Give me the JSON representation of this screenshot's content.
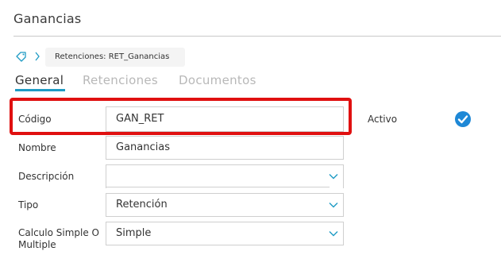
{
  "header": {
    "title": "Ganancias"
  },
  "breadcrumb": {
    "item": "Retenciones: RET_Ganancias"
  },
  "tabs": [
    {
      "label": "General",
      "active": true
    },
    {
      "label": "Retenciones",
      "active": false
    },
    {
      "label": "Documentos",
      "active": false
    }
  ],
  "form": {
    "codigo": {
      "label": "Código",
      "value": "GAN_RET"
    },
    "nombre": {
      "label": "Nombre",
      "value": "Ganancias"
    },
    "descripcion": {
      "label": "Descripción",
      "value": ""
    },
    "tipo": {
      "label": "Tipo",
      "value": "Retención"
    },
    "calculo": {
      "label_line1": "Calculo Simple O",
      "label_line2": "Multiple",
      "value": "Simple"
    },
    "activo": {
      "label": "Activo",
      "checked": true
    }
  },
  "colors": {
    "accent": "#1e9bc4",
    "highlight": "#e01010",
    "check": "#1e88d6"
  },
  "icons": {
    "breadcrumb_tag": "tag-icon",
    "breadcrumb_separator": "chevron-right-icon",
    "dropdown": "chevron-down-icon",
    "checkbox": "checkmark-circle-icon"
  }
}
